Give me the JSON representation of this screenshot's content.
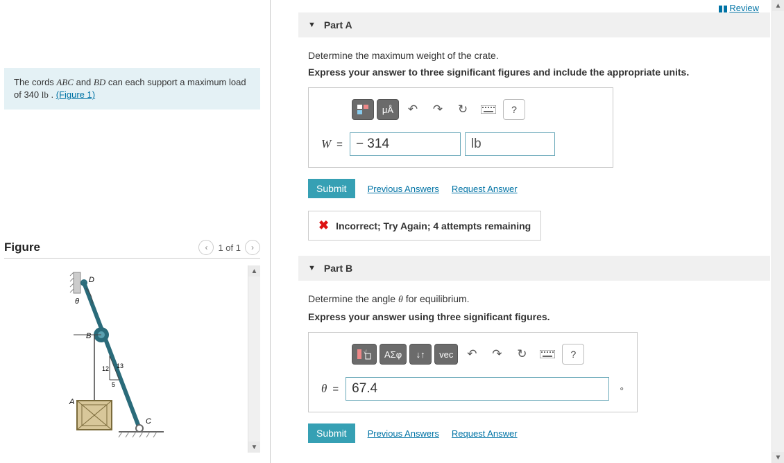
{
  "review_label": "Review",
  "problem": {
    "prefix": "The cords ",
    "var1": "ABC",
    "mid1": " and ",
    "var2": "BD",
    "mid2": " can each support a maximum load of 340 ",
    "unit": "lb",
    "suffix": " . ",
    "fig_link": "(Figure 1)"
  },
  "figure": {
    "title": "Figure",
    "counter": "1 of 1",
    "labels": {
      "D": "D",
      "B": "B",
      "A": "A",
      "C": "C",
      "theta": "θ",
      "n1": "12",
      "n2": "13",
      "n3": "5"
    }
  },
  "partA": {
    "title": "Part A",
    "prompt": "Determine the maximum weight of the crate.",
    "instr": "Express your answer to three significant figures and include the appropriate units.",
    "var": "W",
    "value": "− 314",
    "unit_value": "lb",
    "submit": "Submit",
    "prev": "Previous Answers",
    "req": "Request Answer",
    "feedback": "Incorrect; Try Again; 4 attempts remaining",
    "tb": {
      "units": "μÅ",
      "help": "?"
    }
  },
  "partB": {
    "title": "Part B",
    "prompt_pre": "Determine the angle ",
    "prompt_var": "θ",
    "prompt_post": " for equilibrium.",
    "instr": "Express your answer using three significant figures.",
    "var": "θ",
    "value": "67.4",
    "degree": "∘",
    "submit": "Submit",
    "prev": "Previous Answers",
    "req": "Request Answer",
    "tb": {
      "greek": "ΑΣφ",
      "updown": "↓↑",
      "vec": "vec",
      "help": "?"
    }
  }
}
